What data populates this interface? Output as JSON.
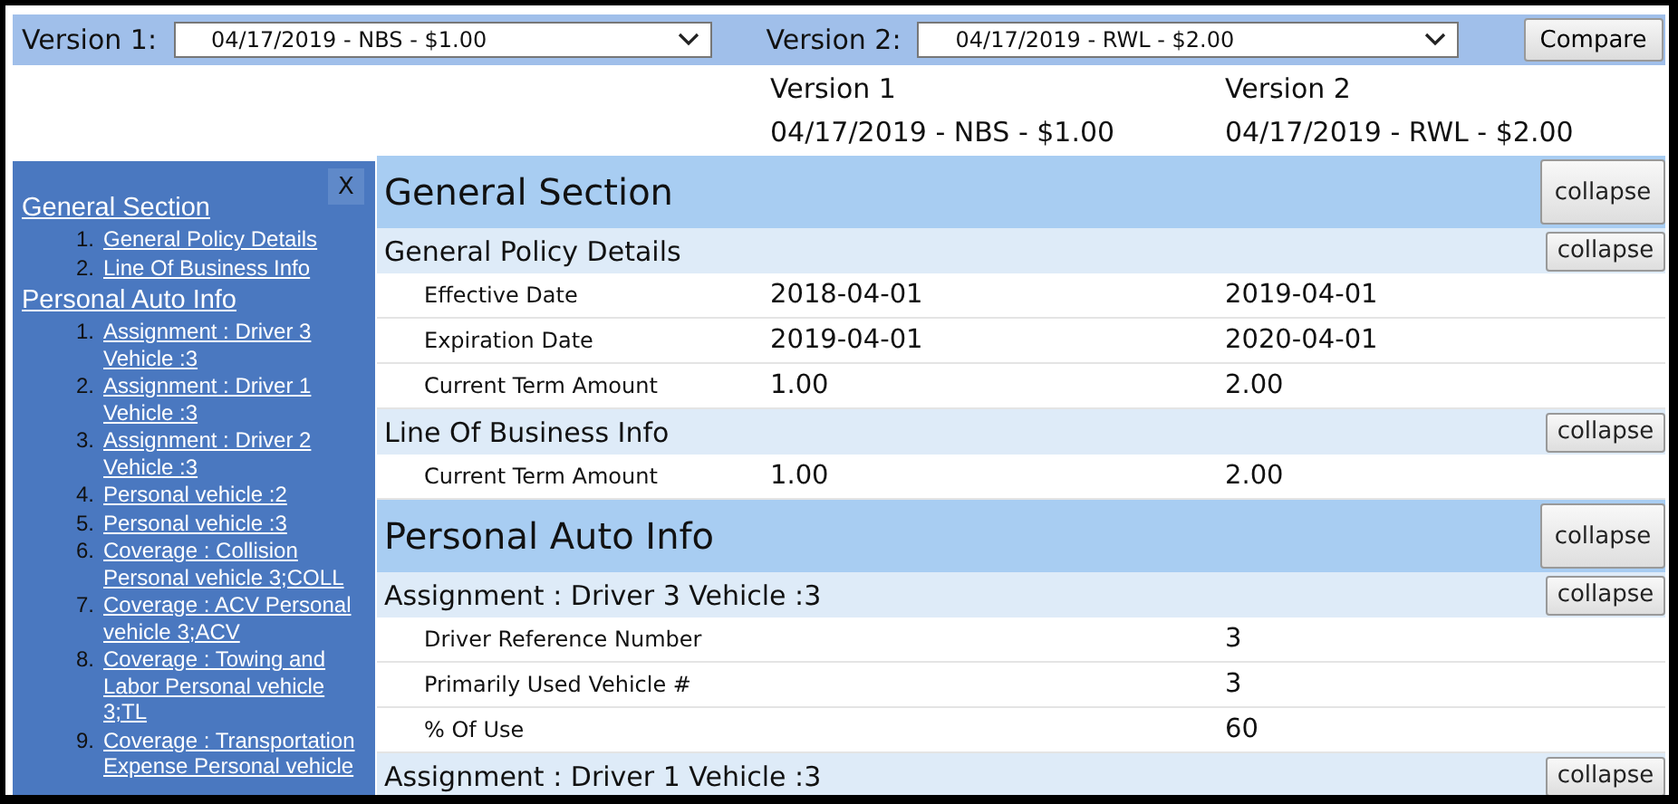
{
  "toolbar": {
    "version_1_label": "Version 1:",
    "version_1_value": "04/17/2019 - NBS - $1.00",
    "version_2_label": "Version 2:",
    "version_2_value": "04/17/2019 - RWL - $2.00",
    "compare_button": "Compare"
  },
  "columns": [
    {
      "title": "Version 1",
      "subtitle": "04/17/2019 - NBS - $1.00"
    },
    {
      "title": "Version 2",
      "subtitle": "04/17/2019 - RWL - $2.00"
    }
  ],
  "sidebar": {
    "close_button": "X",
    "sections": [
      {
        "title": "General Section",
        "items": [
          {
            "number": "1.",
            "label": "General Policy Details"
          },
          {
            "number": "2.",
            "label": "Line Of Business Info"
          }
        ]
      },
      {
        "title": "Personal Auto Info",
        "items": [
          {
            "number": "1.",
            "label": "Assignment : Driver 3 Vehicle :3"
          },
          {
            "number": "2.",
            "label": "Assignment : Driver 1 Vehicle :3"
          },
          {
            "number": "3.",
            "label": "Assignment : Driver 2 Vehicle :3"
          },
          {
            "number": "4.",
            "label": "Personal vehicle :2"
          },
          {
            "number": "5.",
            "label": "Personal vehicle :3"
          },
          {
            "number": "6.",
            "label": "Coverage : Collision Personal vehicle 3;COLL"
          },
          {
            "number": "7.",
            "label": "Coverage : ACV Personal vehicle 3;ACV"
          },
          {
            "number": "8.",
            "label": "Coverage : Towing and Labor Personal vehicle 3;TL"
          },
          {
            "number": "9.",
            "label": "Coverage : Transportation Expense Personal vehicle"
          }
        ]
      }
    ]
  },
  "sections": [
    {
      "title": "General Section",
      "button": "collapse",
      "groups": [
        {
          "title": "General Policy Details",
          "button": "collapse",
          "rows": [
            {
              "label": "Effective Date",
              "version_1": "2018-04-01",
              "version_2": "2019-04-01"
            },
            {
              "label": "Expiration Date",
              "version_1": "2019-04-01",
              "version_2": "2020-04-01"
            },
            {
              "label": "Current Term Amount",
              "version_1": "1.00",
              "version_2": "2.00"
            }
          ]
        },
        {
          "title": "Line Of Business Info",
          "button": "collapse",
          "rows": [
            {
              "label": "Current Term Amount",
              "version_1": "1.00",
              "version_2": "2.00"
            }
          ]
        }
      ]
    },
    {
      "title": "Personal Auto Info",
      "button": "collapse",
      "groups": [
        {
          "title": "Assignment : Driver 3 Vehicle :3",
          "button": "collapse",
          "rows": [
            {
              "label": "Driver Reference Number",
              "version_2": "3"
            },
            {
              "label": "Primarily Used Vehicle #",
              "version_2": "3"
            },
            {
              "label": "% Of Use",
              "version_2": "60"
            }
          ]
        },
        {
          "title": "Assignment : Driver 1 Vehicle :3",
          "button": "collapse"
        }
      ]
    }
  ]
}
